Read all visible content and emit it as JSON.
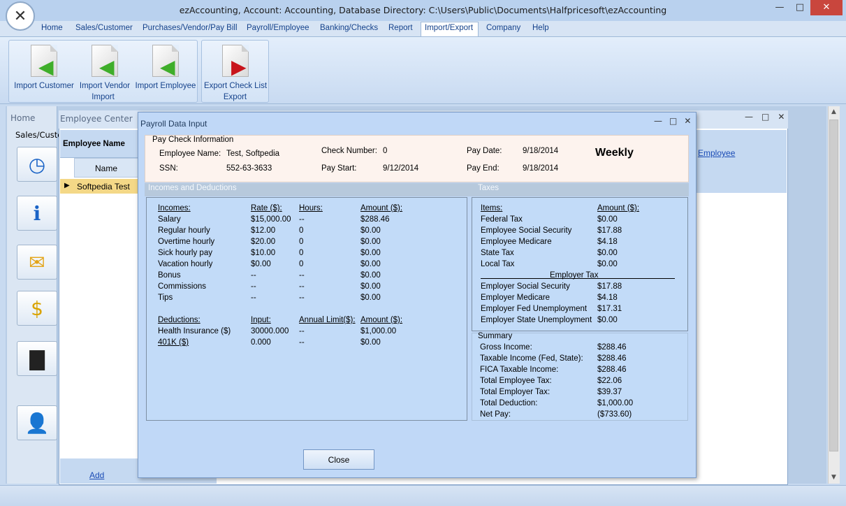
{
  "window": {
    "title": "ezAccounting, Account: Accounting, Database Directory: C:\\Users\\Public\\Documents\\Halfpricesoft\\ezAccounting",
    "controls": {
      "minimize": "—",
      "maximize": "□",
      "close": "✕"
    }
  },
  "menu": [
    "Home",
    "Sales/Customer",
    "Purchases/Vendor/Pay Bill",
    "Payroll/Employee",
    "Banking/Checks",
    "Report",
    "Import/Export",
    "Company",
    "Help"
  ],
  "menu_active": "Import/Export",
  "ribbon": {
    "import_group": {
      "label": "Import",
      "buttons": [
        "Import Customer",
        "Import Vendor",
        "Import Employee"
      ]
    },
    "export_group": {
      "label": "Export",
      "buttons": [
        "Export Check List"
      ]
    }
  },
  "sidebar": {
    "home_tab": "Home",
    "section": "Sales/Custo"
  },
  "employee_center": {
    "title": "Employee Center",
    "list_header": "Employee Name",
    "column": "Name",
    "rows": [
      "Softpedia Test"
    ],
    "add_link": "Add",
    "right_link": "Employee"
  },
  "dialog": {
    "title": "Payroll Data Input",
    "paycheck": {
      "legend": "Pay Check Information",
      "employee_name_label": "Employee Name:",
      "employee_name": "Test, Softpedia",
      "ssn_label": "SSN:",
      "ssn": "552-63-3633",
      "check_number_label": "Check Number:",
      "check_number": "0",
      "pay_start_label": "Pay Start:",
      "pay_start": "9/12/2014",
      "pay_date_label": "Pay Date:",
      "pay_date": "9/18/2014",
      "pay_end_label": "Pay End:",
      "pay_end": "9/18/2014",
      "frequency": "Weekly"
    },
    "incomes_section": "Incomes and Deductions",
    "taxes_section": "Taxes",
    "incomes_header": [
      "Incomes:",
      "Rate ($):",
      "Hours:",
      "Amount ($):"
    ],
    "incomes": [
      [
        "Salary",
        "$15,000.00",
        "--",
        "$288.46"
      ],
      [
        "Regular hourly",
        "$12.00",
        "0",
        "$0.00"
      ],
      [
        "Overtime hourly",
        "$20.00",
        "0",
        "$0.00"
      ],
      [
        "Sick hourly pay",
        "$10.00",
        "0",
        "$0.00"
      ],
      [
        "Vacation hourly",
        "$0.00",
        "0",
        "$0.00"
      ],
      [
        "Bonus",
        "--",
        "--",
        "$0.00"
      ],
      [
        "Commissions",
        "--",
        "--",
        "$0.00"
      ],
      [
        "Tips",
        "--",
        "--",
        "$0.00"
      ]
    ],
    "deductions_header": [
      "Deductions:",
      "Input:",
      "Annual Limit($):",
      "Amount ($):"
    ],
    "deductions": [
      [
        "Health Insurance  ($)",
        "30000.000",
        "--",
        "$1,000.00"
      ],
      [
        "401K  ($)",
        "0.000",
        "--",
        "$0.00"
      ]
    ],
    "taxes_header": [
      "Items:",
      "Amount ($):"
    ],
    "employee_taxes": [
      [
        "Federal Tax",
        "$0.00"
      ],
      [
        "Employee Social Security",
        "$17.88"
      ],
      [
        "Employee Medicare",
        "$4.18"
      ],
      [
        "State Tax",
        "$0.00"
      ],
      [
        "Local Tax",
        "$0.00"
      ]
    ],
    "employer_tax_title": "Employer Tax",
    "employer_taxes": [
      [
        "Employer Social Security",
        "$17.88"
      ],
      [
        "Employer Medicare",
        "$4.18"
      ],
      [
        "Employer Fed Unemployment",
        "$17.31"
      ],
      [
        "Employer State Unemployment",
        "$0.00"
      ]
    ],
    "summary_title": "Summary",
    "summary": [
      [
        "Gross Income:",
        "$288.46"
      ],
      [
        "Taxable Income (Fed, State):",
        "$288.46"
      ],
      [
        "FICA Taxable Income:",
        "$288.46"
      ],
      [
        "Total Employee Tax:",
        "$22.06"
      ],
      [
        "Total Employer Tax:",
        "$39.37"
      ],
      [
        "Total Deduction:",
        "$1,000.00"
      ],
      [
        "Net Pay:",
        "($733.60)"
      ]
    ],
    "close_button": "Close"
  },
  "colors": {
    "accent": "#15428b",
    "selected_row": "#f4d887",
    "close_red": "#c9463d"
  }
}
